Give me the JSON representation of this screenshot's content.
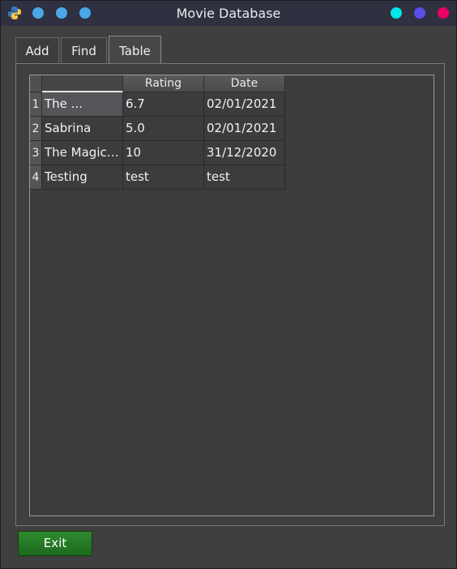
{
  "window": {
    "title": "Movie Database",
    "controls": [
      {
        "name": "minimize-button",
        "color": "#00e5e5"
      },
      {
        "name": "maximize-button",
        "color": "#5a4ee8"
      },
      {
        "name": "close-button",
        "color": "#ee0066"
      }
    ],
    "left_dots_color": "#4aa8e8"
  },
  "tabs": [
    {
      "label": "Add"
    },
    {
      "label": "Find"
    },
    {
      "label": "Table",
      "active": true
    }
  ],
  "table": {
    "headers": [
      "",
      "Rating",
      "Date"
    ],
    "rows": [
      {
        "index": "1",
        "title": "The ...",
        "rating": "6.7",
        "date": "02/01/2021"
      },
      {
        "index": "2",
        "title": "Sabrina",
        "rating": "5.0",
        "date": "02/01/2021"
      },
      {
        "index": "3",
        "title": "The Magic…",
        "rating": "10",
        "date": "31/12/2020"
      },
      {
        "index": "4",
        "title": "Testing",
        "rating": "test",
        "date": "test"
      }
    ]
  },
  "footer": {
    "exit_label": "Exit"
  }
}
